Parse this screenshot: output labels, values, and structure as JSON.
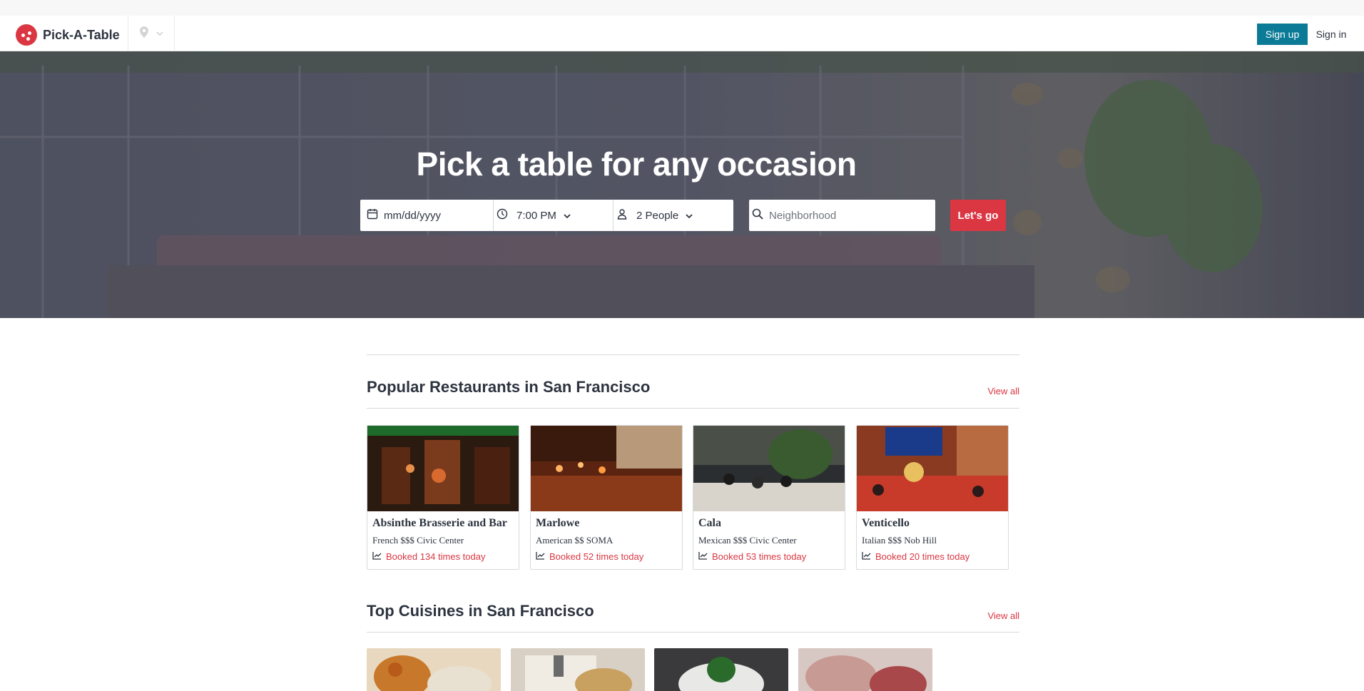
{
  "app": {
    "name": "Pick-A-Table"
  },
  "header": {
    "signup_label": "Sign up",
    "signin_label": "Sign in"
  },
  "hero": {
    "title": "Pick a table for any occasion",
    "date_placeholder": "mm/dd/yyyy",
    "time_value": "7:00 PM",
    "party_value": "2 People",
    "neighborhood_placeholder": "Neighborhood",
    "go_label": "Let's go"
  },
  "popular": {
    "title": "Popular Restaurants in San Francisco",
    "view_all": "View all",
    "restaurants": [
      {
        "name": "Absinthe Brasserie and Bar",
        "meta": "French $$$ Civic Center",
        "booked": "Booked 134 times today"
      },
      {
        "name": "Marlowe",
        "meta": "American $$ SOMA",
        "booked": "Booked 52 times today"
      },
      {
        "name": "Cala",
        "meta": "Mexican $$$ Civic Center",
        "booked": "Booked 53 times today"
      },
      {
        "name": "Venticello",
        "meta": "Italian $$$ Nob Hill",
        "booked": "Booked 20 times today"
      }
    ]
  },
  "cuisines": {
    "title": "Top Cuisines in San Francisco",
    "view_all": "View all"
  },
  "colors": {
    "brand_red": "#da3743",
    "signup_teal": "#0b7a96",
    "text_dark": "#2d333f"
  },
  "icons": [
    "logo-icon",
    "location-pin-icon",
    "chevron-down-icon",
    "calendar-icon",
    "clock-icon",
    "person-icon",
    "search-icon",
    "trending-icon"
  ]
}
